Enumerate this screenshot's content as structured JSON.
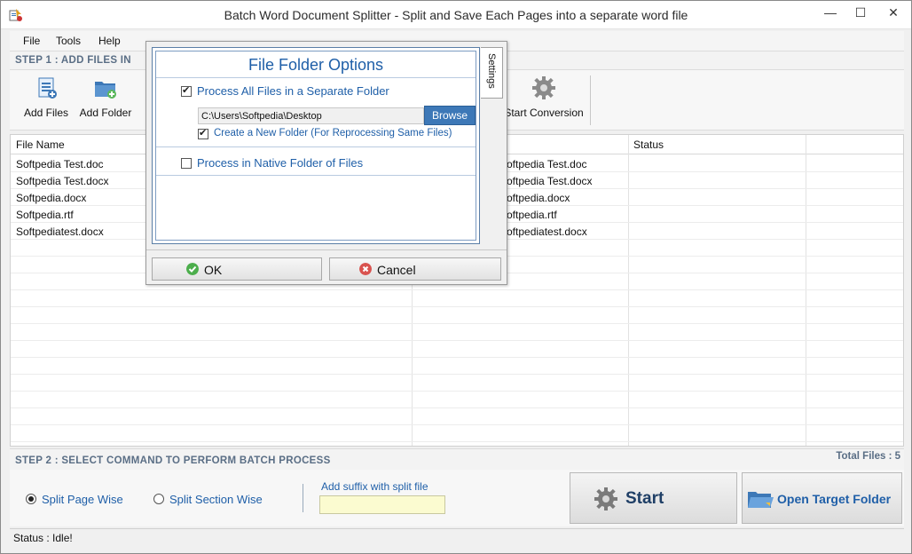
{
  "window": {
    "title": "Batch Word Document Splitter - Split and Save Each Pages into a separate word file",
    "min_glyph": "—",
    "max_glyph": "☐",
    "close_glyph": "✕"
  },
  "menu": {
    "file": "File",
    "tools": "Tools",
    "help": "Help"
  },
  "step1": {
    "label": "STEP 1 : ADD FILES IN"
  },
  "toolbar": {
    "add_files": "Add Files",
    "add_folder": "Add Folder",
    "start_conversion": "Start Conversion"
  },
  "grid": {
    "col_file_name": "File Name",
    "col_status": "Status",
    "rows": [
      {
        "name": "Softpedia Test.doc",
        "output": "oftpedia Test.doc",
        "status": ""
      },
      {
        "name": "Softpedia Test.docx",
        "output": "oftpedia Test.docx",
        "status": ""
      },
      {
        "name": "Softpedia.docx",
        "output": "oftpedia.docx",
        "status": ""
      },
      {
        "name": "Softpedia.rtf",
        "output": "oftpedia.rtf",
        "status": ""
      },
      {
        "name": "Softpediatest.docx",
        "output": "oftpediatest.docx",
        "status": ""
      }
    ]
  },
  "step2": {
    "label": "STEP 2 : SELECT COMMAND TO PERFORM BATCH PROCESS",
    "total_files": "Total Files : 5"
  },
  "commands": {
    "split_page_wise": "Split Page Wise",
    "split_section_wise": "Split Section Wise",
    "selected": "split_page_wise",
    "suffix_label": "Add suffix with split file",
    "suffix_value": "",
    "start": "Start",
    "open_target_folder": "Open Target Folder"
  },
  "status": {
    "text": "Status  :  Idle!"
  },
  "dialog": {
    "title": "File Folder Options",
    "process_separate": "Process All Files in a Separate Folder",
    "process_separate_checked": true,
    "path": "C:\\Users\\Softpedia\\Desktop",
    "browse": "Browse",
    "create_new_folder": "Create a New Folder (For Reprocessing Same Files)",
    "create_new_folder_checked": true,
    "process_native": "Process in Native Folder of Files",
    "process_native_checked": false,
    "settings_tab": "Settings",
    "ok": "OK",
    "cancel": "Cancel"
  },
  "colors": {
    "accent_blue": "#1f5fa8",
    "browse_blue": "#3d78b7",
    "step_text": "#5a6e85",
    "suffix_bg": "#fbfbd0"
  }
}
